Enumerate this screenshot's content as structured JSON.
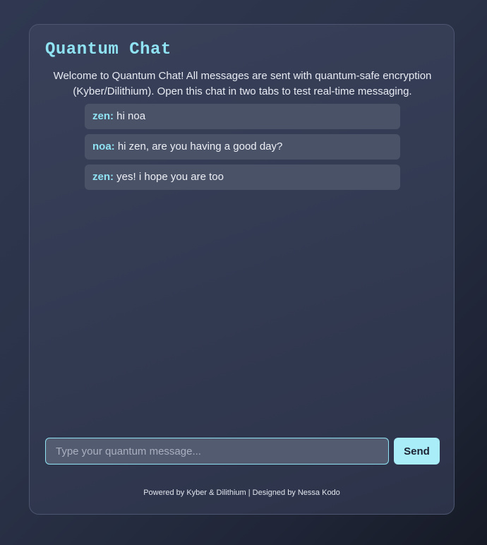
{
  "app": {
    "title": "Quantum Chat",
    "welcome": "Welcome to Quantum Chat! All messages are sent with quantum-safe encryption (Kyber/Dilithium). Open this chat in two tabs to test real-time messaging."
  },
  "messages": [
    {
      "sender": "zen:",
      "text": "hi noa"
    },
    {
      "sender": "noa:",
      "text": "hi zen, are you having a good day?"
    },
    {
      "sender": "zen:",
      "text": "yes! i hope you are too"
    }
  ],
  "composer": {
    "placeholder": "Type your quantum message...",
    "value": "",
    "send_label": "Send"
  },
  "footer": {
    "text": "Powered by Kyber & Dilithium | Designed by Nessa Kodo"
  },
  "colors": {
    "accent": "#8fe3f2",
    "button": "#a8edf7",
    "message_bg": "#4a5268"
  }
}
